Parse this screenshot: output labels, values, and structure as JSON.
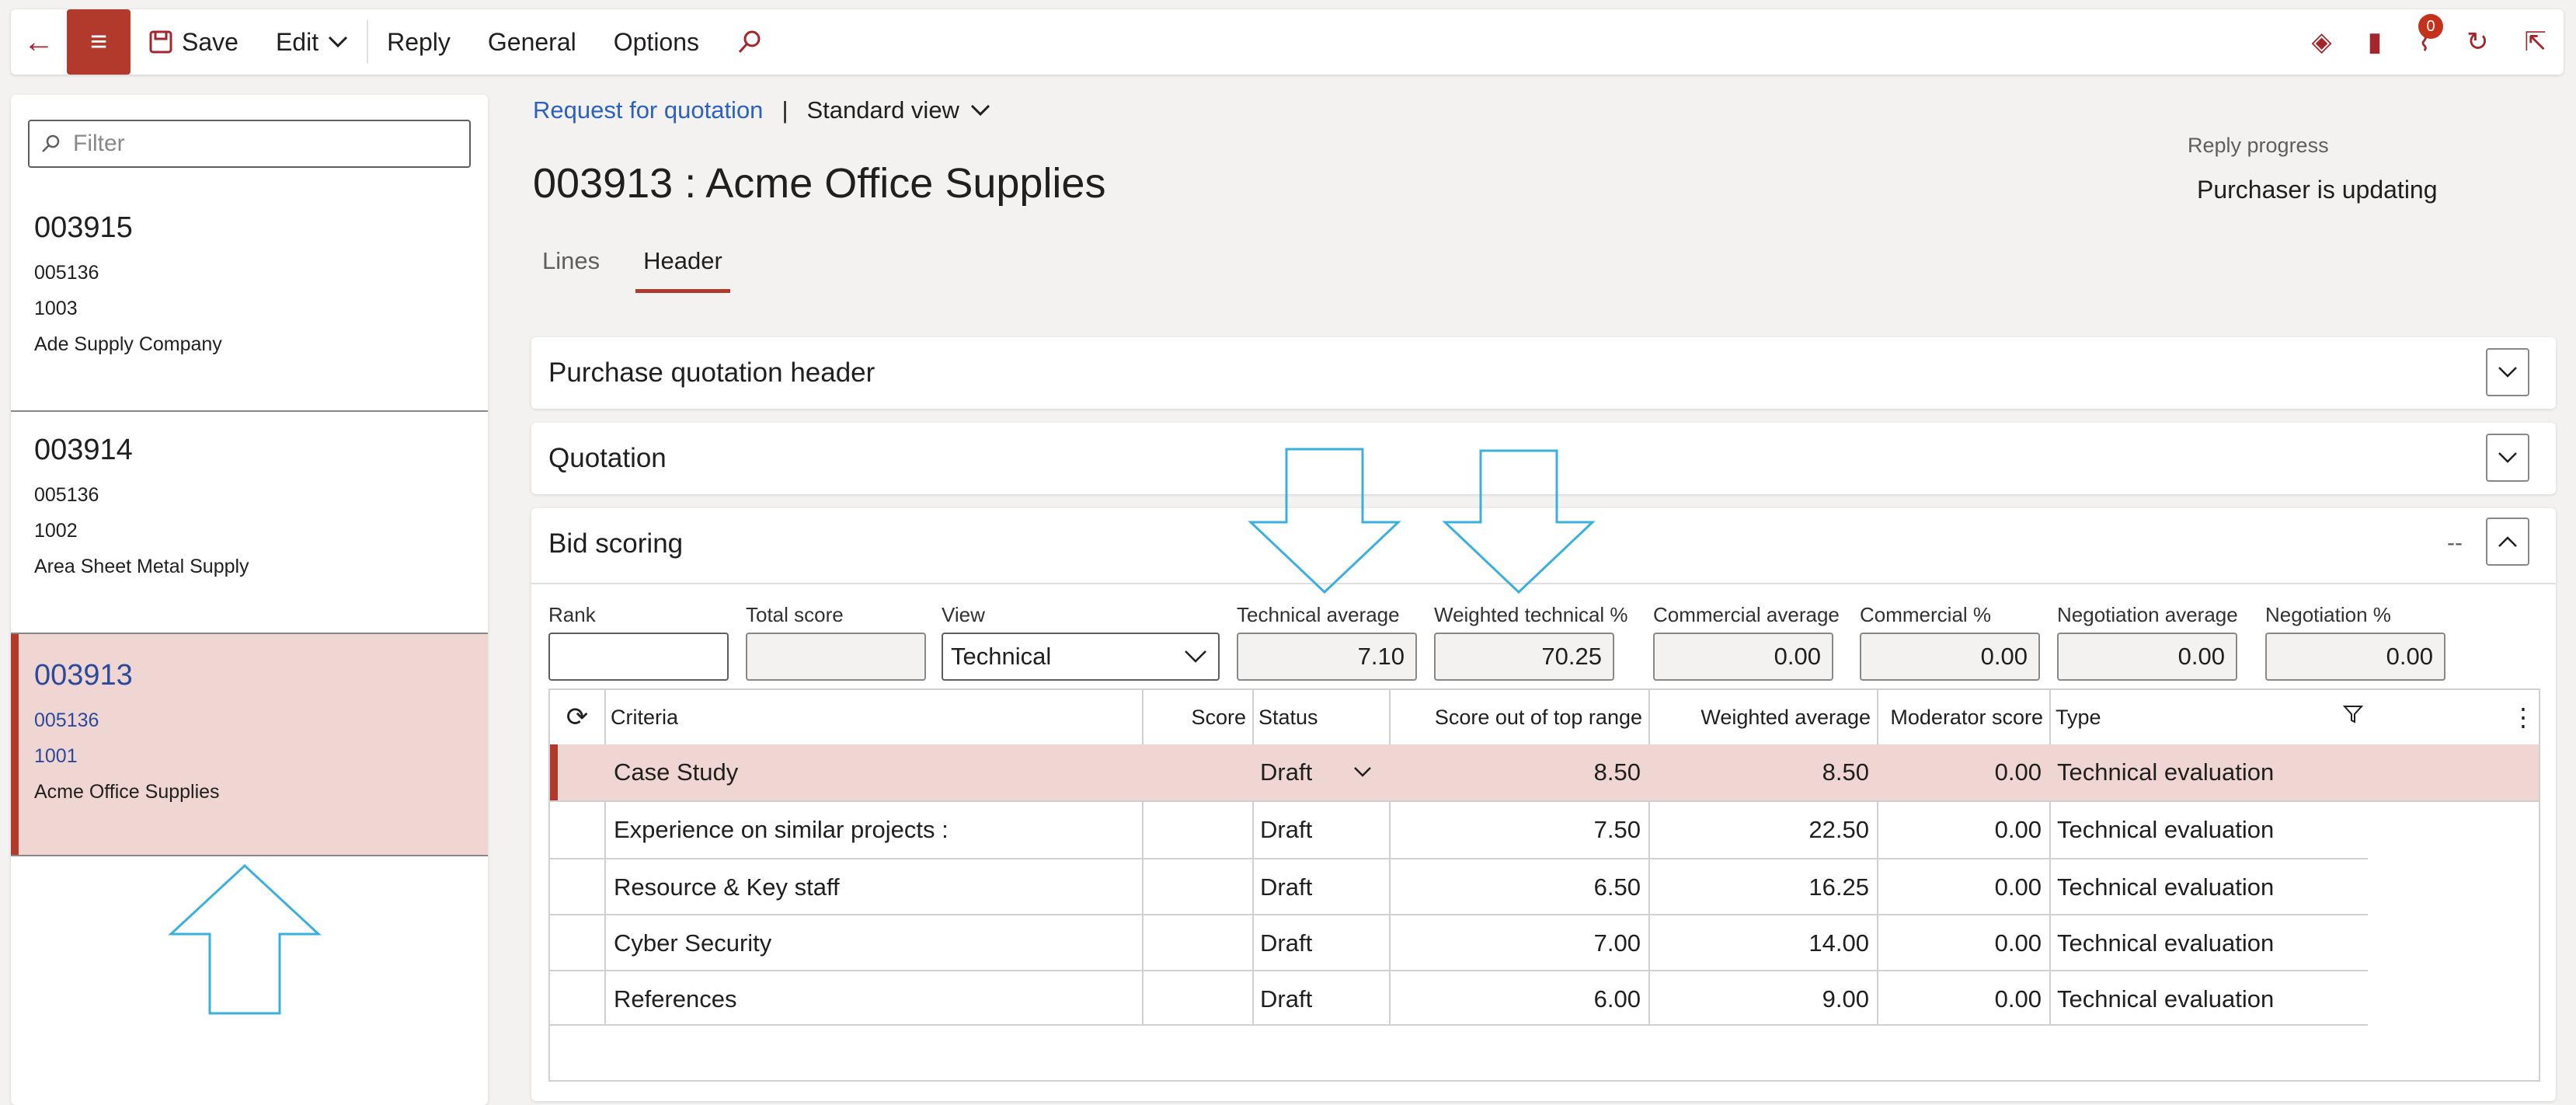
{
  "toolbar": {
    "save_label": "Save",
    "edit_label": "Edit",
    "reply_label": "Reply",
    "general_label": "General",
    "options_label": "Options",
    "notification_count": "0"
  },
  "filter": {
    "placeholder": "Filter"
  },
  "list": [
    {
      "id": "003915",
      "line1": "005136",
      "line2": "1003",
      "vendor": "Ade Supply Company"
    },
    {
      "id": "003914",
      "line1": "005136",
      "line2": "1002",
      "vendor": "Area Sheet Metal Supply"
    },
    {
      "id": "003913",
      "line1": "005136",
      "line2": "1001",
      "vendor": "Acme Office Supplies"
    }
  ],
  "breadcrumb": {
    "link": "Request for quotation",
    "separator": "|",
    "view": "Standard view"
  },
  "page_title": "003913 : Acme Office Supplies",
  "tabs": [
    "Lines",
    "Header"
  ],
  "reply_progress": {
    "label": "Reply progress",
    "value": "Purchaser is updating"
  },
  "sections": {
    "header": "Purchase quotation header",
    "quotation": "Quotation",
    "bid": "Bid scoring",
    "bid_summary": "--"
  },
  "fields": {
    "rank": {
      "label": "Rank",
      "value": ""
    },
    "total_score": {
      "label": "Total score",
      "value": ""
    },
    "view": {
      "label": "View",
      "value": "Technical"
    },
    "tech_avg": {
      "label": "Technical average",
      "value": "7.10"
    },
    "weighted_tech": {
      "label": "Weighted technical %",
      "value": "70.25"
    },
    "comm_avg": {
      "label": "Commercial average",
      "value": "0.00"
    },
    "comm_pct": {
      "label": "Commercial %",
      "value": "0.00"
    },
    "neg_avg": {
      "label": "Negotiation average",
      "value": "0.00"
    },
    "neg_pct": {
      "label": "Negotiation %",
      "value": "0.00"
    }
  },
  "grid": {
    "headers": {
      "criteria": "Criteria",
      "score": "Score",
      "status": "Status",
      "score_top": "Score out of top range",
      "weighted_avg": "Weighted average",
      "moderator": "Moderator score",
      "type": "Type"
    },
    "rows": [
      {
        "criteria": "Case Study",
        "score": "",
        "status": "Draft",
        "score_top": "8.50",
        "weighted_avg": "8.50",
        "moderator": "0.00",
        "type": "Technical evaluation"
      },
      {
        "criteria": "Experience on similar projects :",
        "score": "",
        "status": "Draft",
        "score_top": "7.50",
        "weighted_avg": "22.50",
        "moderator": "0.00",
        "type": "Technical evaluation"
      },
      {
        "criteria": "Resource & Key staff",
        "score": "",
        "status": "Draft",
        "score_top": "6.50",
        "weighted_avg": "16.25",
        "moderator": "0.00",
        "type": "Technical evaluation"
      },
      {
        "criteria": "Cyber Security",
        "score": "",
        "status": "Draft",
        "score_top": "7.00",
        "weighted_avg": "14.00",
        "moderator": "0.00",
        "type": "Technical evaluation"
      },
      {
        "criteria": "References",
        "score": "",
        "status": "Draft",
        "score_top": "6.00",
        "weighted_avg": "9.00",
        "moderator": "0.00",
        "type": "Technical evaluation"
      }
    ]
  },
  "colors": {
    "accent": "#b23a2c",
    "selection": "#efd6d3",
    "link": "#2b61c2",
    "annotation_arrow": "#3bb0dd"
  }
}
